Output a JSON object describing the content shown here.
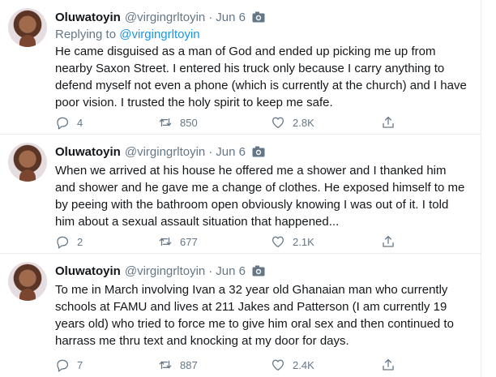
{
  "tweets": [
    {
      "author_name": "Oluwatoyin",
      "author_handle": "@virgingrltoyin",
      "separator": "·",
      "date": "Jun 6",
      "replying_prefix": "Replying to",
      "replying_handle": "@virgingrltoyin",
      "text": "He came disguised as a man of God and ended up picking me up from nearby Saxon Street. I entered his truck only because I carry anything to defend myself not even a phone (which is currently at the church) and I have poor vision. I trusted the holy spirit to keep me safe.",
      "replies": "4",
      "retweets": "850",
      "likes": "2.8K"
    },
    {
      "author_name": "Oluwatoyin",
      "author_handle": "@virgingrltoyin",
      "separator": "·",
      "date": "Jun 6",
      "text": "When we arrived at his house he offered me a shower and I thanked him and shower and he gave me a change of clothes. He exposed himself to me by peeing with the bathroom open obviously knowing I was out of it. I told him about a sexual assault situation that happened...",
      "replies": "2",
      "retweets": "677",
      "likes": "2.1K"
    },
    {
      "author_name": "Oluwatoyin",
      "author_handle": "@virgingrltoyin",
      "separator": "·",
      "date": "Jun 6",
      "text": "To me in March involving Ivan a 32 year old Ghanaian man who currently schools at FAMU and lives at 211 Jakes and Patterson (I am currently 19 years old) who tried to force me to give him oral sex and then continued to harrass me thru text and knocking at my door for days.",
      "replies": "7",
      "retweets": "887",
      "likes": "2.4K"
    }
  ],
  "icons": {
    "media": "camera-icon",
    "reply": "speech-bubble-icon",
    "retweet": "retweet-arrows-icon",
    "like": "heart-icon",
    "share": "share-upload-icon"
  },
  "colors": {
    "text": "#14171a",
    "secondary": "#657786",
    "link": "#1b95e0",
    "divider": "#e6ecf0"
  }
}
